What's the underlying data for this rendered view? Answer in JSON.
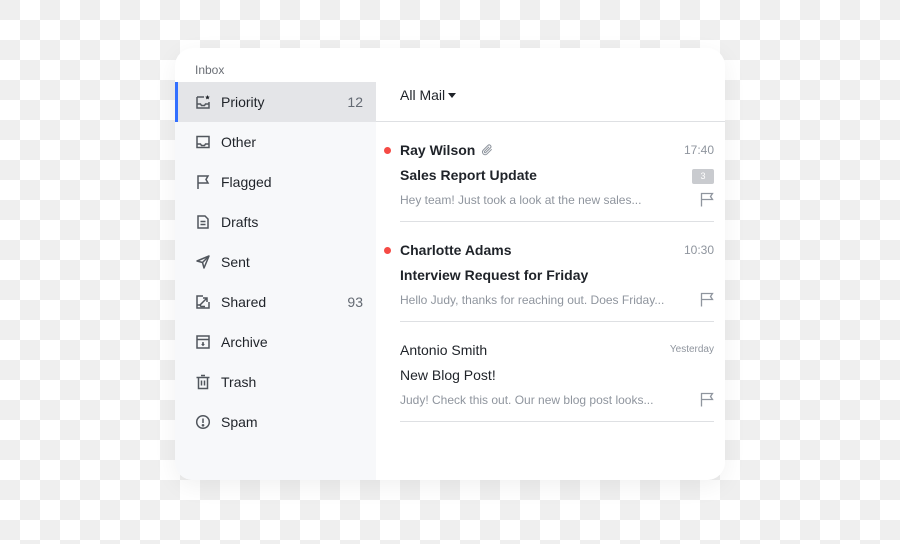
{
  "sidebar": {
    "section_label": "Inbox",
    "items": [
      {
        "label": "Priority",
        "icon": "inbox-star-icon",
        "count": "12",
        "active": true
      },
      {
        "label": "Other",
        "icon": "inbox-icon",
        "count": ""
      },
      {
        "label": "Flagged",
        "icon": "flag-icon",
        "count": ""
      },
      {
        "label": "Drafts",
        "icon": "draft-icon",
        "count": ""
      },
      {
        "label": "Sent",
        "icon": "send-icon",
        "count": ""
      },
      {
        "label": "Shared",
        "icon": "shared-icon",
        "count": "93"
      },
      {
        "label": "Archive",
        "icon": "archive-icon",
        "count": ""
      },
      {
        "label": "Trash",
        "icon": "trash-icon",
        "count": ""
      },
      {
        "label": "Spam",
        "icon": "spam-icon",
        "count": ""
      }
    ]
  },
  "main": {
    "filter_label": "All Mail",
    "mails": [
      {
        "sender": "Ray Wilson",
        "unread": true,
        "has_attachment": true,
        "time": "17:40",
        "subject": "Sales Report Update",
        "thread_count": "3",
        "preview": "Hey team! Just took a look at the new sales..."
      },
      {
        "sender": "Charlotte Adams",
        "unread": true,
        "has_attachment": false,
        "time": "10:30",
        "subject": "Interview Request for Friday",
        "thread_count": "",
        "preview": "Hello Judy, thanks for reaching out. Does Friday..."
      },
      {
        "sender": "Antonio Smith",
        "unread": false,
        "has_attachment": false,
        "time": "Yesterday",
        "subject": "New Blog Post!",
        "thread_count": "",
        "preview": "Judy! Check this out. Our new blog post looks..."
      }
    ]
  },
  "colors": {
    "accent": "#3370ff",
    "unread_dot": "#f54a45",
    "active_item_bg": "#e4e5e8",
    "sidebar_bg": "#f7f8fa"
  }
}
